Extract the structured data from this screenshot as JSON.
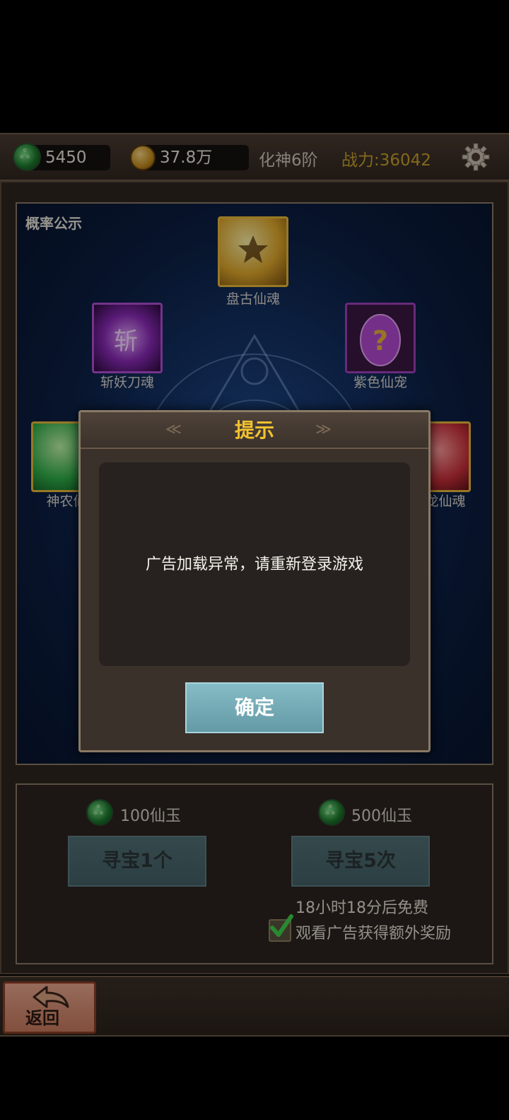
{
  "topbar": {
    "jade_amount": "5450",
    "gold_amount": "37.8万",
    "realm": "化神6阶",
    "power": "战力:36042"
  },
  "arena": {
    "probability_label": "概率公示",
    "items": [
      {
        "name": "盘古仙魂",
        "color": "#e8b93a"
      },
      {
        "name": "斩妖刀魂",
        "color": "#b24fd6"
      },
      {
        "name": "紫色仙宠",
        "color": "#a13fbf"
      },
      {
        "name": "神农仙",
        "color": "#3cc25a"
      },
      {
        "name": "龙仙魂",
        "color": "#c8303a"
      }
    ]
  },
  "shop": {
    "single": {
      "cost": "100仙玉",
      "button": "寻宝1个"
    },
    "multi": {
      "cost": "500仙玉",
      "button": "寻宝5次"
    },
    "free_timer": "18小时18分后免费",
    "ad_option": "观看广告获得额外奖励"
  },
  "back_button": "返回",
  "dialog": {
    "title": "提示",
    "message": "广告加载异常，请重新登录游戏",
    "confirm": "确定"
  },
  "colors": {
    "accent_gold": "#f2c230",
    "power_text": "#c9a12c",
    "confirm_button": "#7aafb9"
  }
}
